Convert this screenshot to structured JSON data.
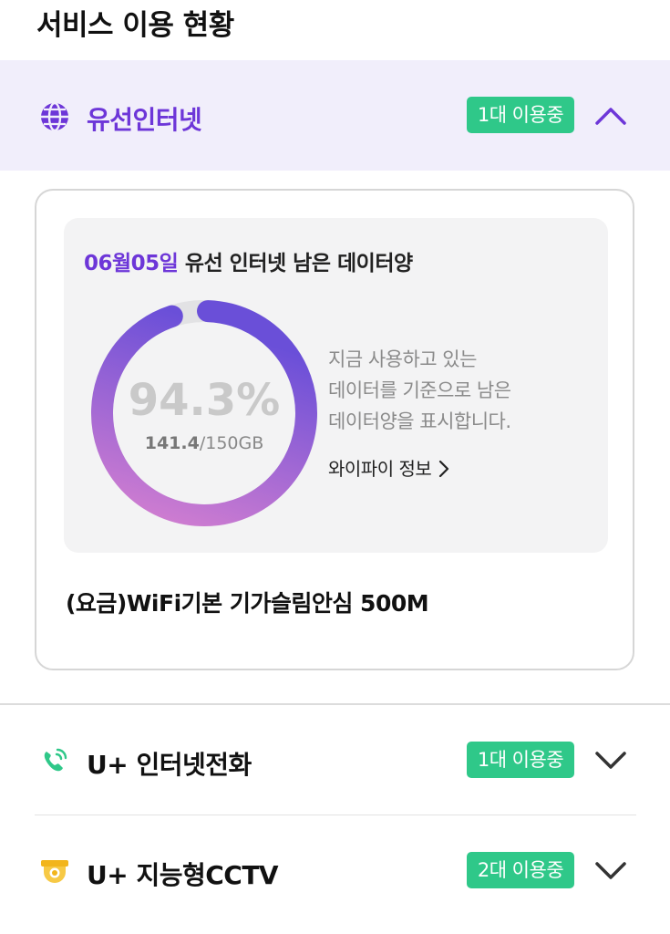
{
  "page": {
    "section_title": "서비스 이용 현황"
  },
  "services": [
    {
      "name": "유선인터넷",
      "icon": "globe-icon",
      "badge": "1대 이용중",
      "state": "expanded",
      "chevron": "chevron-up-icon"
    },
    {
      "name": "U+ 인터넷전화",
      "icon": "phone-icon",
      "badge": "1대 이용중",
      "state": "collapsed",
      "chevron": "chevron-down-icon"
    },
    {
      "name": "U+ 지능형CCTV",
      "icon": "cctv-icon",
      "badge": "2대 이용중",
      "state": "collapsed",
      "chevron": "chevron-down-icon"
    }
  ],
  "usage": {
    "date": "06월05일",
    "title_rest": " 유선 인터넷 남은 데이터양",
    "percent_text": "94.3%",
    "percent_value": 94.3,
    "used_amount": "141.4",
    "total_amount": "/150GB",
    "description": [
      "지금 사용하고 있는",
      "데이터를 기준으로 남은",
      "데이터양을 표시합니다."
    ],
    "wifi_link": "와이파이 정보"
  },
  "plan": {
    "name": "(요금)WiFi기본 기가슬림안심 500M"
  },
  "colors": {
    "accent": "#6d36d8",
    "badge_green": "#2fc889",
    "header_bg": "#f1eefb",
    "donut_start": "#d47fd0",
    "donut_end": "#6a4fd8",
    "donut_track": "#e2e2e4"
  }
}
